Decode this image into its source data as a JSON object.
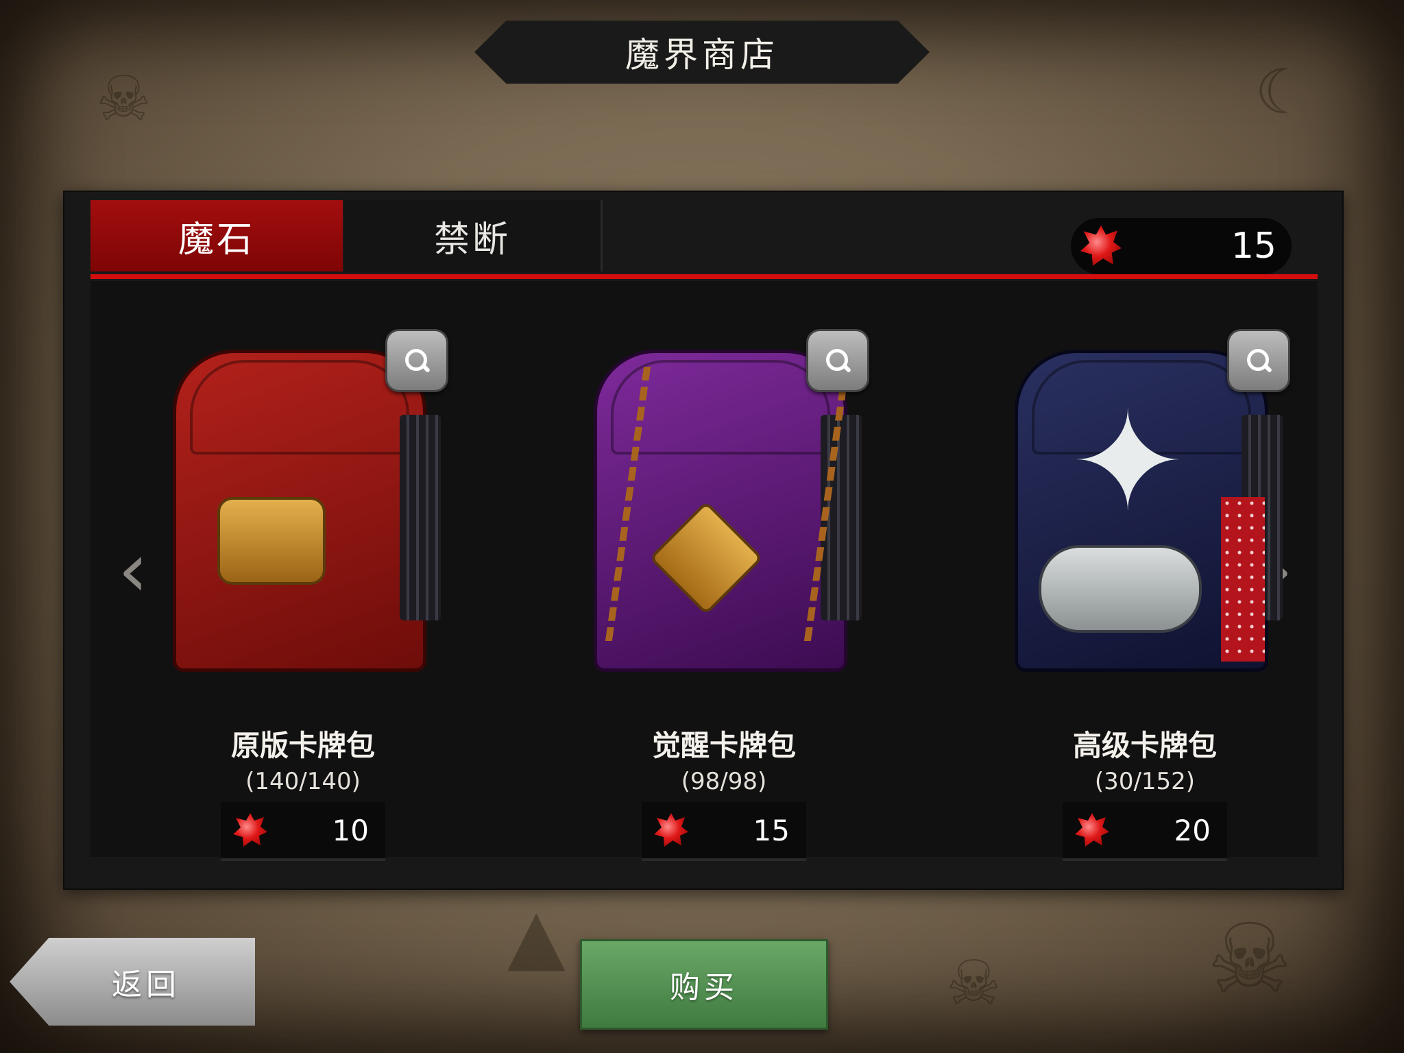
{
  "title": "魔界商店",
  "tabs": [
    {
      "label": "魔石",
      "active": true
    },
    {
      "label": "禁断",
      "active": false
    }
  ],
  "currency": {
    "icon": "red-gem-icon",
    "amount": "15"
  },
  "nav": {
    "prev_icon": "chevron-left-icon",
    "next_icon": "chevron-right-icon",
    "prev_glyph": "‹",
    "next_glyph": "›"
  },
  "packs": [
    {
      "name": "原版卡牌包",
      "count": "(140/140)",
      "price": "10",
      "chest_color": "#b3211b"
    },
    {
      "name": "觉醒卡牌包",
      "count": "(98/98)",
      "price": "15",
      "chest_color": "#7e2a9a"
    },
    {
      "name": "高级卡牌包",
      "count": "(30/152)",
      "price": "20",
      "chest_color": "#2a3060"
    }
  ],
  "buttons": {
    "back": "返回",
    "buy": "购买"
  },
  "colors": {
    "accent_red": "#d40d0d",
    "tab_active": "#a30e0e",
    "buy_green": "#4f8f4d"
  },
  "decor": {
    "butterfly_glyph": "✦"
  }
}
